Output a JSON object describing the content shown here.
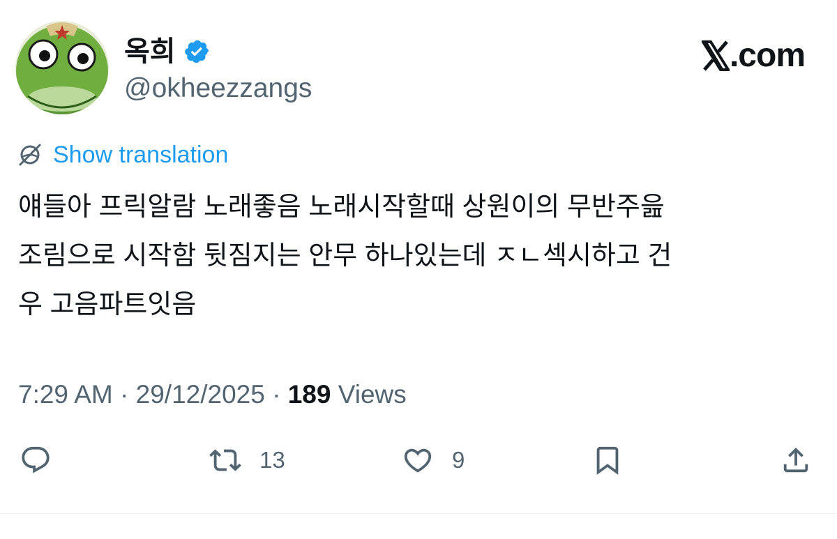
{
  "author": {
    "display_name": "옥희",
    "handle": "@okheezzangs",
    "verified": true,
    "avatar_icon": "frog-character-avatar"
  },
  "site": {
    "domain_text": ".com",
    "logo_icon": "x-logo-icon"
  },
  "translation": {
    "label": "Show translation",
    "icon": "translate-globe-icon"
  },
  "tweet": {
    "lines": [
      "얘들아 프릭알람 노래좋음 노래시작할때 상원이의 무반주읊",
      "조림으로 시작함 뒷짐지는 안무 하나있는데 ㅈㄴ섹시하고 건",
      "우 고음파트잇음"
    ]
  },
  "meta": {
    "time": "7:29 AM",
    "separator": "·",
    "date": "29/12/2025",
    "views_count": "189",
    "views_label": "Views"
  },
  "actions": {
    "reply_count": "",
    "retweet_count": "13",
    "like_count": "9"
  },
  "colors": {
    "link": "#1d9bf0",
    "secondary_text": "#536471",
    "primary_text": "#0f1419",
    "verified": "#1d9bf0"
  }
}
